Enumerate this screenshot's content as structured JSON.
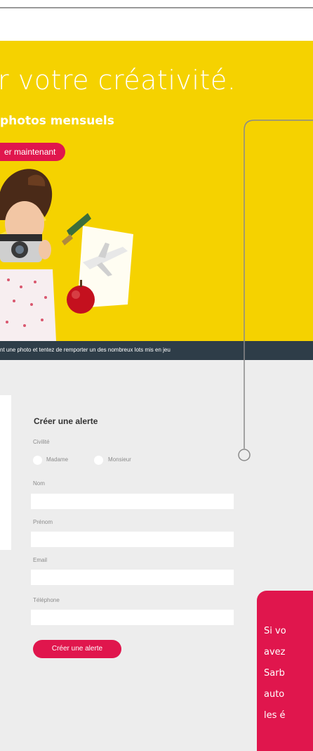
{
  "banner": {
    "headline": "r votre créativité.",
    "subheading": "photos mensuels",
    "cta_label": "er maintenant",
    "strip_text": "nt une photo et tentez de remporter un des nombreux lots mis en jeu",
    "background_color": "#f5d200",
    "strip_color": "#2e3d48"
  },
  "form": {
    "title": "Créer une alerte",
    "civility_label": "Civilité",
    "civility_options": [
      "Madame",
      "Monsieur"
    ],
    "fields": {
      "nom": {
        "label": "Nom",
        "value": ""
      },
      "prenom": {
        "label": "Prénom",
        "value": ""
      },
      "email": {
        "label": "Email",
        "value": ""
      },
      "telephone": {
        "label": "Téléphone",
        "value": ""
      }
    },
    "submit_label": "Créer une alerte"
  },
  "info_box": {
    "lines": [
      "Si vo",
      "avez",
      "Sarb",
      "auto",
      "les é"
    ],
    "color": "#e0164d"
  },
  "accent_color": "#e0164d"
}
